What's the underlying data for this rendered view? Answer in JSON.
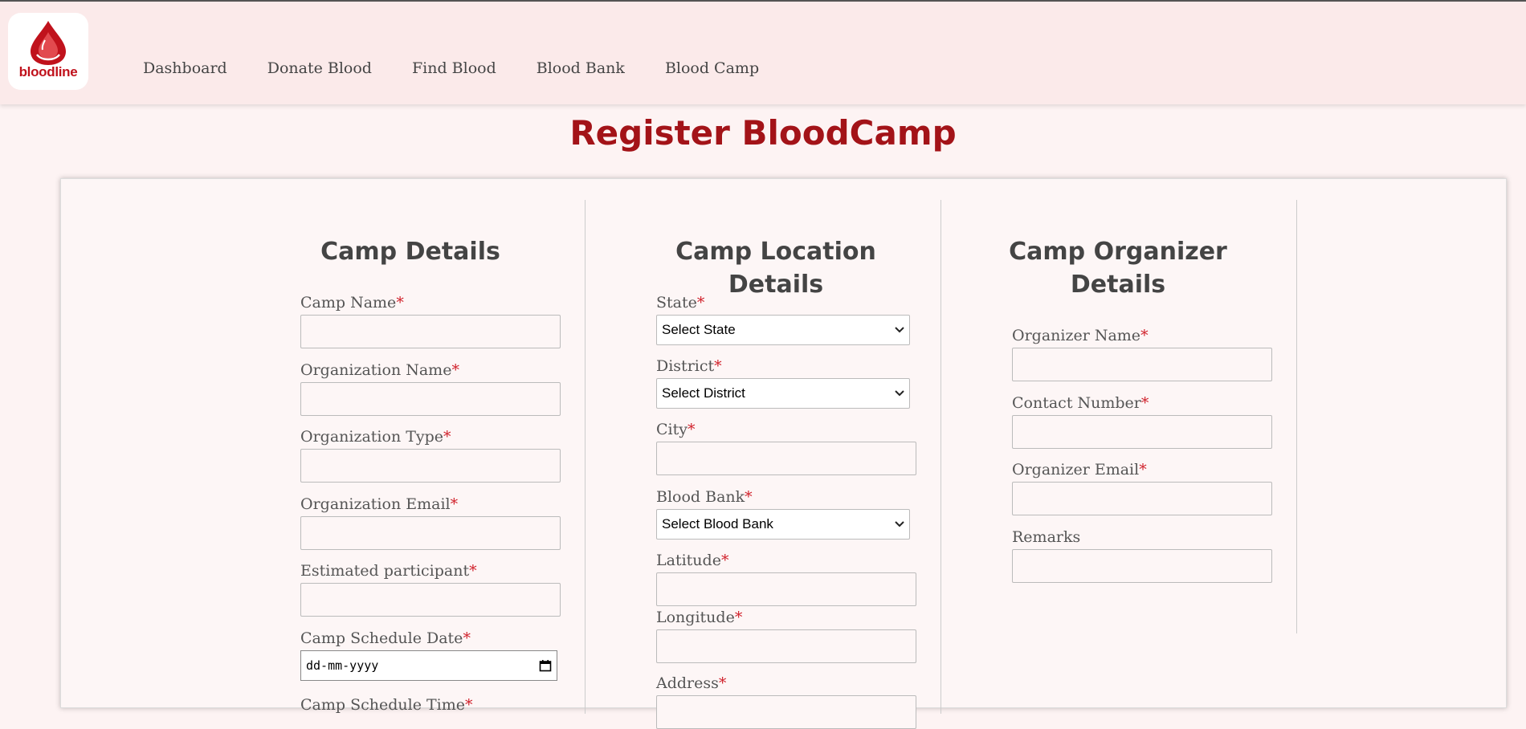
{
  "app": {
    "logo_text": "bloodline",
    "colors": {
      "brand": "#c0121c",
      "title": "#a31318",
      "required": "#d0202a",
      "header_bg": "#fbeaea",
      "page_bg": "#fdf3f3"
    }
  },
  "nav": {
    "items": [
      {
        "label": "Dashboard"
      },
      {
        "label": "Donate Blood"
      },
      {
        "label": "Find Blood"
      },
      {
        "label": "Blood Bank"
      },
      {
        "label": "Blood Camp"
      }
    ]
  },
  "page": {
    "title": "Register BloodCamp"
  },
  "required_mark": "*",
  "camp_details": {
    "heading": "Camp Details",
    "camp_name": {
      "label": "Camp Name",
      "value": ""
    },
    "organization_name": {
      "label": "Organization Name",
      "value": ""
    },
    "organization_type": {
      "label": "Organization Type",
      "value": ""
    },
    "organization_email": {
      "label": "Organization Email",
      "value": ""
    },
    "estimated_participant": {
      "label": "Estimated participant",
      "value": ""
    },
    "schedule_date": {
      "label": "Camp Schedule Date",
      "placeholder": "dd-mm-yyyy"
    },
    "schedule_time": {
      "label": "Camp Schedule Time"
    }
  },
  "location_details": {
    "heading": "Camp Location Details",
    "state": {
      "label": "State",
      "selected": "Select State"
    },
    "district": {
      "label": "District",
      "selected": "Select District"
    },
    "city": {
      "label": "City",
      "value": ""
    },
    "blood_bank": {
      "label": "Blood Bank",
      "selected": "Select Blood Bank"
    },
    "latitude": {
      "label": "Latitude",
      "value": ""
    },
    "longitude": {
      "label": "Longitude",
      "value": ""
    },
    "address": {
      "label": "Address"
    }
  },
  "organizer_details": {
    "heading_line1": "Camp Organizer",
    "heading_line2": "Details",
    "organizer_name": {
      "label": "Organizer Name",
      "value": ""
    },
    "contact_number": {
      "label": "Contact Number",
      "value": ""
    },
    "organizer_email": {
      "label": "Organizer Email",
      "value": ""
    },
    "remarks": {
      "label": "Remarks",
      "value": ""
    }
  }
}
